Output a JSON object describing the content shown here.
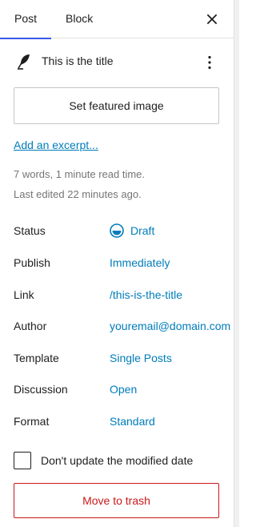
{
  "tabs": {
    "post": "Post",
    "block": "Block"
  },
  "post": {
    "title": "This is the title"
  },
  "featured_image_label": "Set featured image",
  "excerpt_link": "Add an excerpt...",
  "stats": {
    "words_read_time": "7 words, 1 minute read time.",
    "last_edited": "Last edited 22 minutes ago."
  },
  "settings": [
    {
      "label": "Status",
      "value": "Draft"
    },
    {
      "label": "Publish",
      "value": "Immediately"
    },
    {
      "label": "Link",
      "value": "/this-is-the-title"
    },
    {
      "label": "Author",
      "value": "youremail@domain.com"
    },
    {
      "label": "Template",
      "value": "Single Posts"
    },
    {
      "label": "Discussion",
      "value": "Open"
    },
    {
      "label": "Format",
      "value": "Standard"
    }
  ],
  "modified_date_checkbox": {
    "label": "Don't update the modified date",
    "checked": false
  },
  "trash_button": "Move to trash",
  "colors": {
    "accent": "#3858e9",
    "link": "#007cba",
    "danger": "#cc1818",
    "muted": "#757575"
  },
  "icons": {
    "title": "feather-icon",
    "close": "close-icon",
    "more": "more-vertical-icon",
    "status": "draft-status-icon"
  }
}
